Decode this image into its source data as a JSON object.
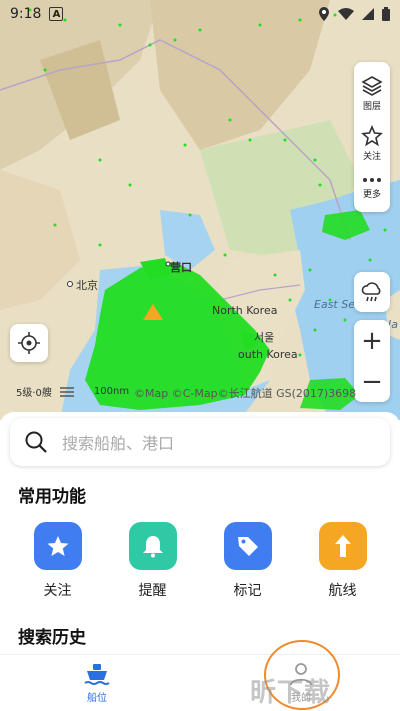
{
  "status_bar": {
    "time": "9:18",
    "notif_badge": "A"
  },
  "map": {
    "labels": {
      "beijing": "北京",
      "yingkou": "营口",
      "north_korea": "North Korea",
      "seoul": "서울",
      "south_korea": "outh Korea",
      "east_sea": "East Se",
      "ja": "Ja"
    },
    "scale_level": "5级·0艘",
    "scale_distance": "100nm",
    "copyright": "©Map ©C-Map©长江航道 GS(2017)3698",
    "colors": {
      "land": "#e8e0c8",
      "sea": "#9fd0f0",
      "ships": "#22dd22",
      "warning": "#f5a623"
    }
  },
  "map_tools": {
    "layers_label": "图层",
    "follow_label": "关注",
    "more_label": "更多"
  },
  "search": {
    "placeholder": "搜索船舶、港口"
  },
  "common_features": {
    "title": "常用功能",
    "items": [
      {
        "label": "关注",
        "icon": "star-icon",
        "color": "#3f7df0"
      },
      {
        "label": "提醒",
        "icon": "bell-icon",
        "color": "#2fc9a6"
      },
      {
        "label": "标记",
        "icon": "tag-icon",
        "color": "#3f7df0"
      },
      {
        "label": "航线",
        "icon": "route-arrow-icon",
        "color": "#f5a623"
      }
    ]
  },
  "history": {
    "title": "搜索历史"
  },
  "tabbar": {
    "ship_position": "船位",
    "mine": "我的"
  },
  "watermark": "昕下载"
}
